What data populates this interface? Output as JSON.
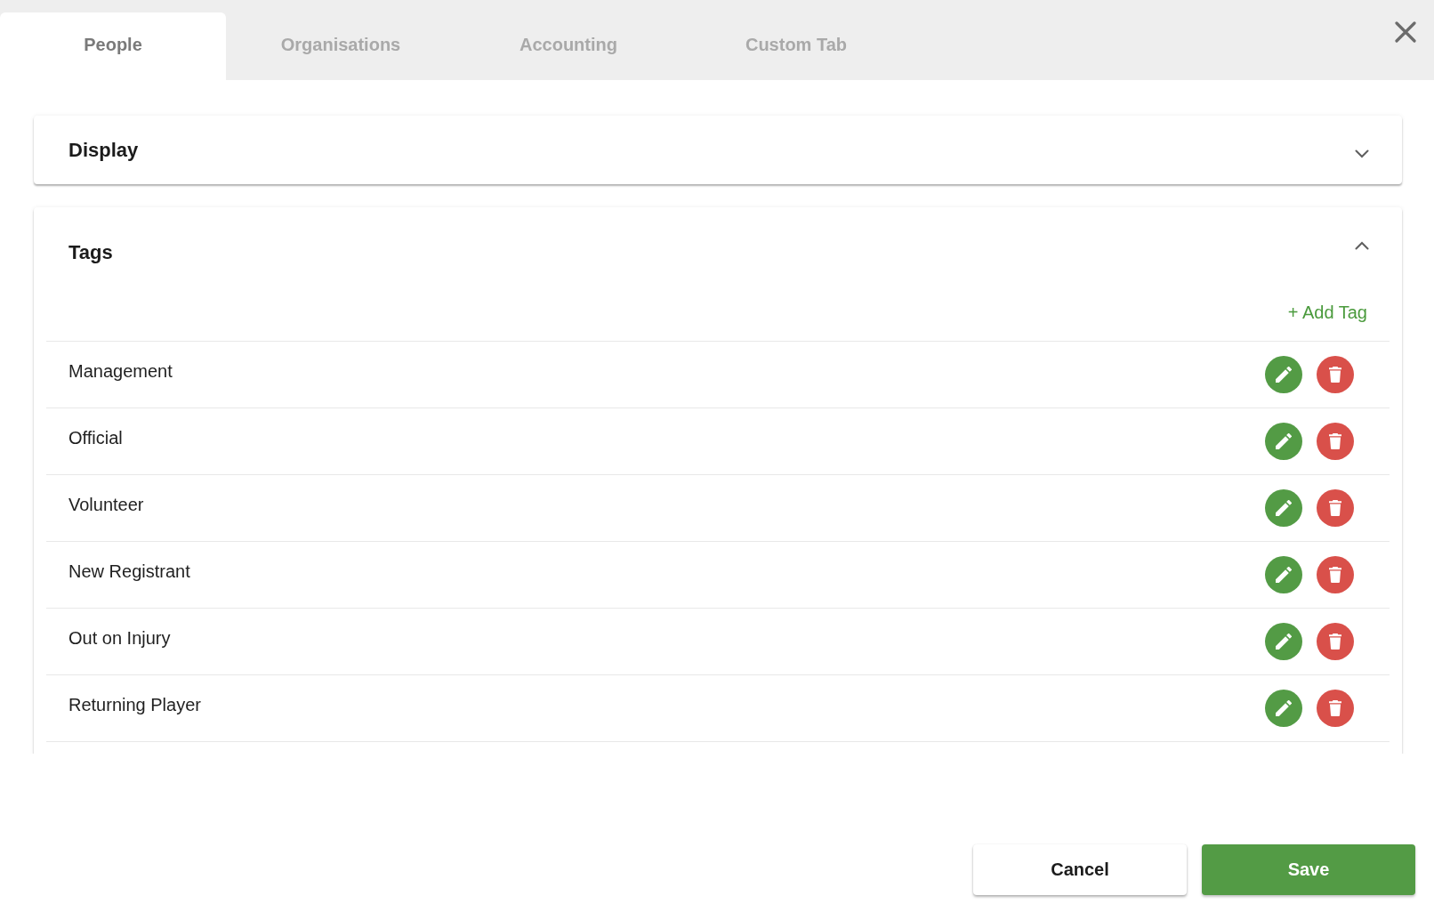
{
  "tabs": [
    {
      "label": "People",
      "selected": true
    },
    {
      "label": "Organisations",
      "selected": false
    },
    {
      "label": "Accounting",
      "selected": false
    },
    {
      "label": "Custom Tab",
      "selected": false
    }
  ],
  "panels": [
    {
      "title": "Display",
      "expanded": false
    },
    {
      "title": "Tags",
      "expanded": true,
      "add_button": "+ Add Tag",
      "tags": [
        "Management",
        "Official",
        "Volunteer",
        "New Registrant",
        "Out on Injury",
        "Returning Player"
      ]
    }
  ],
  "footer": {
    "buttons": [
      {
        "label": "Cancel",
        "kind": "secondary"
      },
      {
        "label": "Save",
        "kind": "primary"
      }
    ]
  }
}
